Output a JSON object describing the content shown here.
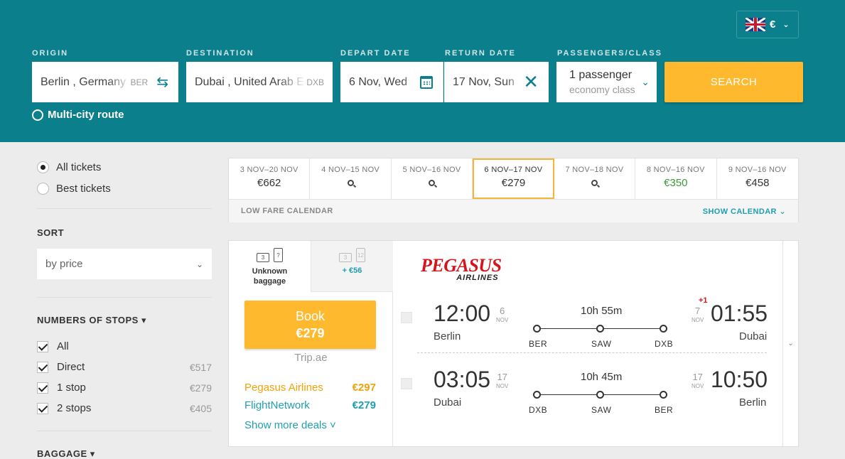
{
  "header": {
    "currency": "€",
    "origin_label": "ORIGIN",
    "origin_value": "Berlin , Germany",
    "origin_code": "BER",
    "destination_label": "DESTINATION",
    "destination_value": "Dubai , United Arab Emirates",
    "destination_code": "DXB",
    "depart_label": "DEPART DATE",
    "depart_value": "6 Nov, Wed",
    "return_label": "RETURN DATE",
    "return_value": "17 Nov, Sun",
    "passengers_label": "PASSENGERS/CLASS",
    "passengers_value": "1 passenger",
    "class_value": "economy class",
    "search_label": "SEARCH",
    "multi_city": "Multi-city route"
  },
  "sidebar": {
    "ticket_types": [
      "All tickets",
      "Best tickets"
    ],
    "sort_heading": "SORT",
    "sort_value": "by price",
    "stops_heading": "NUMBERS OF STOPS ▾",
    "stops": [
      {
        "label": "All",
        "price": ""
      },
      {
        "label": "Direct",
        "price": "€517"
      },
      {
        "label": "1 stop",
        "price": "€279"
      },
      {
        "label": "2 stops",
        "price": "€405"
      }
    ],
    "baggage_heading": "BAGGAGE ▾"
  },
  "date_strip": {
    "cells": [
      {
        "range": "3 NOV–20 NOV",
        "price": "€662"
      },
      {
        "range": "4 NOV–15 NOV",
        "price": ""
      },
      {
        "range": "5 NOV–16 NOV",
        "price": ""
      },
      {
        "range": "6 NOV–17 NOV",
        "price": "€279"
      },
      {
        "range": "7 NOV–18 NOV",
        "price": ""
      },
      {
        "range": "8 NOV–16 NOV",
        "price": "€350"
      },
      {
        "range": "9 NOV–16 NOV",
        "price": "€458"
      }
    ],
    "low_fare_label": "LOW FARE CALENDAR",
    "show_calendar_label": "SHOW CALENDAR"
  },
  "ticket": {
    "baggage_tab1_label": "Unknown baggage",
    "baggage_tab2_label": "+ €56",
    "book_label": "Book",
    "book_price": "€279",
    "via": "Trip.ae",
    "deals": [
      {
        "agent": "Pegasus Airlines",
        "price": "€297"
      },
      {
        "agent": "FlightNetwork",
        "price": "€279"
      }
    ],
    "show_more": "Show more deals ˅",
    "airline_logo": "PEGASUS",
    "airline_logo_sub": "AIRLINES",
    "outbound": {
      "dep_time": "12:00",
      "dep_day": "6",
      "dep_month": "NOV",
      "dep_city": "Berlin",
      "duration": "10h 55m",
      "stops": [
        "BER",
        "SAW",
        "DXB"
      ],
      "plus_day": "+1",
      "arr_time": "01:55",
      "arr_day": "7",
      "arr_month": "NOV",
      "arr_city": "Dubai"
    },
    "inbound": {
      "dep_time": "03:05",
      "dep_day": "17",
      "dep_month": "NOV",
      "dep_city": "Dubai",
      "duration": "10h 45m",
      "stops": [
        "DXB",
        "SAW",
        "BER"
      ],
      "arr_time": "10:50",
      "arr_day": "17",
      "arr_month": "NOV",
      "arr_city": "Berlin"
    }
  },
  "colors": {
    "header_bg": "#0b7f8c",
    "accent_orange": "#ffb92e",
    "link_teal": "#1f9fb0",
    "airline_red": "#d4161c"
  }
}
